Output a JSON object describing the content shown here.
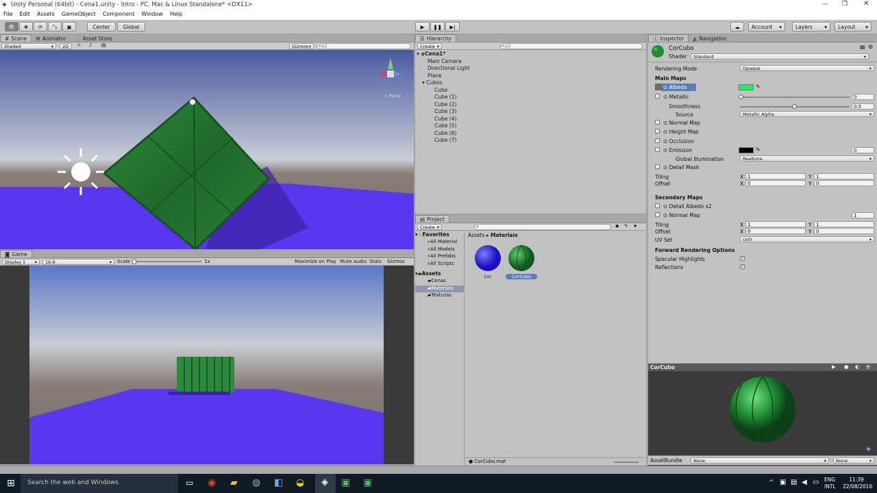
{
  "window": {
    "title": "Unity Personal (64bit) - Cena1.unity - Intro - PC, Mac & Linux Standalone* <DX11>"
  },
  "menu": [
    "File",
    "Edit",
    "Assets",
    "GameObject",
    "Component",
    "Window",
    "Help"
  ],
  "toolbar": {
    "center": "Center",
    "global": "Global",
    "account": "Account",
    "layers": "Layers",
    "layout": "Layout"
  },
  "scene": {
    "tab": "Scene",
    "tab2": "Animator",
    "tab3": "Asset Store",
    "shading": "Shaded",
    "mode2d": "2D",
    "gizmos": "Gizmos",
    "search_placeholder": "All",
    "persp": "< Persp"
  },
  "game": {
    "tab": "Game",
    "display": "Display 1",
    "aspect": "16:9",
    "scale_label": "Scale",
    "scale_value": "1x",
    "maximize": "Maximize on Play",
    "mute": "Mute audio",
    "stats": "Stats",
    "gizmos": "Gizmos"
  },
  "hierarchy": {
    "tab": "Hierarchy",
    "create": "Create",
    "search_placeholder": "All",
    "scene": "Cena1*",
    "items": [
      "Main Camera",
      "Directional Light",
      "Plane"
    ],
    "group": "Cubos",
    "children": [
      "Cube",
      "Cube (1)",
      "Cube (2)",
      "Cube (3)",
      "Cube (4)",
      "Cube (5)",
      "Cube (6)",
      "Cube (7)"
    ]
  },
  "project": {
    "tab": "Project",
    "create": "Create",
    "favorites": "Favorites",
    "fav_items": [
      "All Material",
      "All Models",
      "All Prefabs",
      "All Scripts"
    ],
    "assets": "Assets",
    "folders": [
      "Cenas",
      "Materiais",
      "Texturas"
    ],
    "breadcrumb_root": "Assets",
    "breadcrumb_sep": "▸",
    "breadcrumb_leaf": "Materiais",
    "items": [
      {
        "name": "Cor"
      },
      {
        "name": "CorCubo"
      }
    ],
    "footer": "CorCubo.mat"
  },
  "inspector": {
    "tab": "Inspector",
    "tab2": "Navigation",
    "name": "CorCubo",
    "shader_label": "Shader",
    "shader": "Standard",
    "rendering_mode_label": "Rendering Mode",
    "rendering_mode": "Opaque",
    "main_maps": "Main Maps",
    "albedo": "Albedo",
    "metallic": "Metallic",
    "metallic_value": "0",
    "smoothness": "Smoothness",
    "smoothness_value": "0.5",
    "source": "Source",
    "source_value": "Metallic Alpha",
    "normal_map": "Normal Map",
    "height_map": "Height Map",
    "occlusion": "Occlusion",
    "emission": "Emission",
    "emission_value": "0",
    "gi": "Global Illumination",
    "gi_value": "Realtime",
    "detail_mask": "Detail Mask",
    "tiling": "Tiling",
    "offset": "Offset",
    "tiling_x": "1",
    "tiling_y": "1",
    "offset_x": "0",
    "offset_y": "0",
    "secondary_maps": "Secondary Maps",
    "detail_albedo": "Detail Albedo x2",
    "normal_map2": "Normal Map",
    "normal_map2_value": "1",
    "tiling2_x": "1",
    "tiling2_y": "1",
    "offset2_x": "0",
    "offset2_y": "0",
    "uv_set": "UV Set",
    "uv_set_value": "UV0",
    "forward": "Forward Rendering Options",
    "specular": "Specular Highlights",
    "reflections": "Reflections",
    "x": "X",
    "y": "Y",
    "preview_title": "CorCubo",
    "assetbundle": "AssetBundle",
    "ab_value": "None",
    "ab_value2": "None",
    "colors": {
      "albedo": "#22ee55",
      "emission": "#000000"
    }
  },
  "taskbar": {
    "search": "Search the web and Windows",
    "lang": "ENG",
    "lang2": "INTL",
    "time": "11:39",
    "date": "22/08/2016"
  }
}
